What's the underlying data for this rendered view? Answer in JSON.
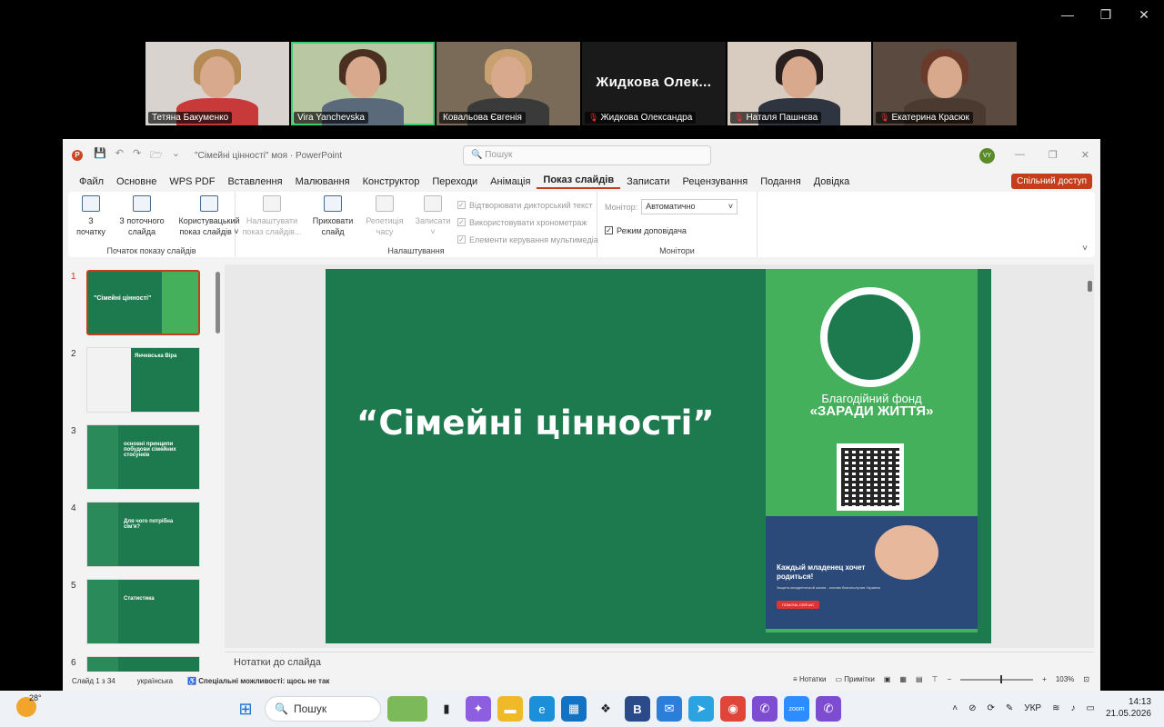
{
  "window_controls": {
    "minimize": "—",
    "restore": "❐",
    "close": "✕"
  },
  "participants": [
    {
      "name": "Тетяна Бакуменко",
      "muted": false,
      "active": false,
      "bg": "#d8d3ce",
      "hair": "#b58a55",
      "body": "#c83a3a"
    },
    {
      "name": "Vira Yanchevska",
      "muted": false,
      "active": true,
      "bg": "#b9c7a2",
      "hair": "#4a3020",
      "body": "#5a6a7a"
    },
    {
      "name": "Ковальова Євгенія",
      "muted": false,
      "active": false,
      "bg": "#7a6a58",
      "hair": "#c9a070",
      "body": "#3a3a3a"
    },
    {
      "name": "Жидкова Олександра",
      "big_label": "Жидкова Олек...",
      "muted": true,
      "active": false,
      "bg": "#1a1a1a"
    },
    {
      "name": "Наталя Пашнєва",
      "muted": true,
      "active": false,
      "bg": "#d8ccc0",
      "hair": "#2a2020",
      "body": "#2f3540"
    },
    {
      "name": "Екатерина Красюк",
      "muted": true,
      "active": false,
      "bg": "#5a4a40",
      "hair": "#6a3a2a",
      "body": "#4a3a30"
    }
  ],
  "powerpoint": {
    "logo": "P",
    "qat": [
      "💾",
      "↶",
      "↷",
      "🗁",
      "⌄"
    ],
    "doc_title": "\"Сімейні цінності\" моя  ·  PowerPoint",
    "search_placeholder": "Пошук",
    "search_icon": "🔍",
    "avatar": "VY",
    "wc": [
      "—",
      "❐",
      "✕"
    ],
    "menu": [
      "Файл",
      "Основне",
      "WPS PDF",
      "Вставлення",
      "Малювання",
      "Конструктор",
      "Переходи",
      "Анімація",
      "Показ слайдів",
      "Записати",
      "Рецензування",
      "Подання",
      "Довідка"
    ],
    "active_menu": "Показ слайдів",
    "share_label": "Спільний доступ",
    "ribbon": {
      "group1_label": "Початок показу слайдів",
      "from_start": "З початку",
      "from_current": "З поточного слайда",
      "custom_show": "Користувацький показ слайдів ˅",
      "setup_show": "Налаштувати показ слайдів...",
      "hide_slide": "Приховати слайд",
      "rehearse": "Репетиція часу",
      "record": "Записати ˅",
      "group2_label": "Налаштування",
      "chk_narration": "Відтворювати дикторський текст",
      "chk_timings": "Використовувати хронометраж",
      "chk_media": "Елементи керування мультимедіа",
      "monitor_label": "Монітор:",
      "monitor_value": "Автоматично",
      "presenter_view": "Режим доповідача",
      "group3_label": "Монітори"
    },
    "thumbnails": [
      {
        "n": "1",
        "text": "\"Сімейні цінності\""
      },
      {
        "n": "2",
        "text": "Янчевська Віра"
      },
      {
        "n": "3",
        "text": "основні принципи побудови сімейних стосунків"
      },
      {
        "n": "4",
        "text": "Для чого потрібна сім'я?"
      },
      {
        "n": "5",
        "text": "Статистика"
      },
      {
        "n": "6",
        "text": ""
      }
    ],
    "slide": {
      "title": "“Сімейні цінності”",
      "fund_line1": "Благодійний фонд",
      "fund_line2": "«ЗАРАДИ ЖИТТЯ»",
      "baby_headline": "Каждый младенец хочет родиться!",
      "baby_sub": "Защита младенческой жизни - основа благополучия Украины",
      "baby_button": "ПОМОЧЬ СЕЙЧАС"
    },
    "notes_placeholder": "Нотатки до слайда",
    "status": {
      "slide_count": "Слайд 1 з 34",
      "language": "українська",
      "accessibility": "Спеціальні можливості: щось не так",
      "notes": "Нотатки",
      "comments": "Примітки",
      "zoom": "103%"
    }
  },
  "taskbar": {
    "temperature": "28°",
    "search": "Пошук",
    "language": "УКР",
    "time": "14:13",
    "date": "21.05.2026"
  }
}
